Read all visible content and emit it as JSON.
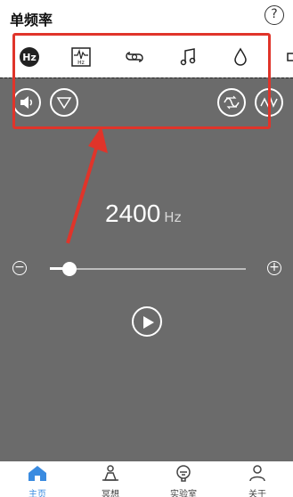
{
  "header": {
    "title": "单频率",
    "help_icon": "?"
  },
  "toolbar": {
    "items": [
      {
        "icon": "hz-icon",
        "text": "Hz",
        "active": true
      },
      {
        "icon": "waveform-hz-icon",
        "text": "Hz"
      },
      {
        "icon": "loop-icon"
      },
      {
        "icon": "music-note-icon"
      },
      {
        "icon": "water-drop-icon"
      }
    ]
  },
  "frequency": {
    "value": "2400",
    "unit": "Hz"
  },
  "slider": {
    "min_symbol": "⊖",
    "max_symbol": "⊕",
    "level": 0.1
  },
  "tabs": [
    {
      "label": "主页",
      "icon": "home-icon",
      "active": true
    },
    {
      "label": "冥想",
      "icon": "meditation-icon"
    },
    {
      "label": "实验室",
      "icon": "lab-icon"
    },
    {
      "label": "关于",
      "icon": "about-icon"
    }
  ],
  "colors": {
    "accent": "#3a8be0",
    "annotation": "#e0342a",
    "background": "#6b6b6b"
  }
}
